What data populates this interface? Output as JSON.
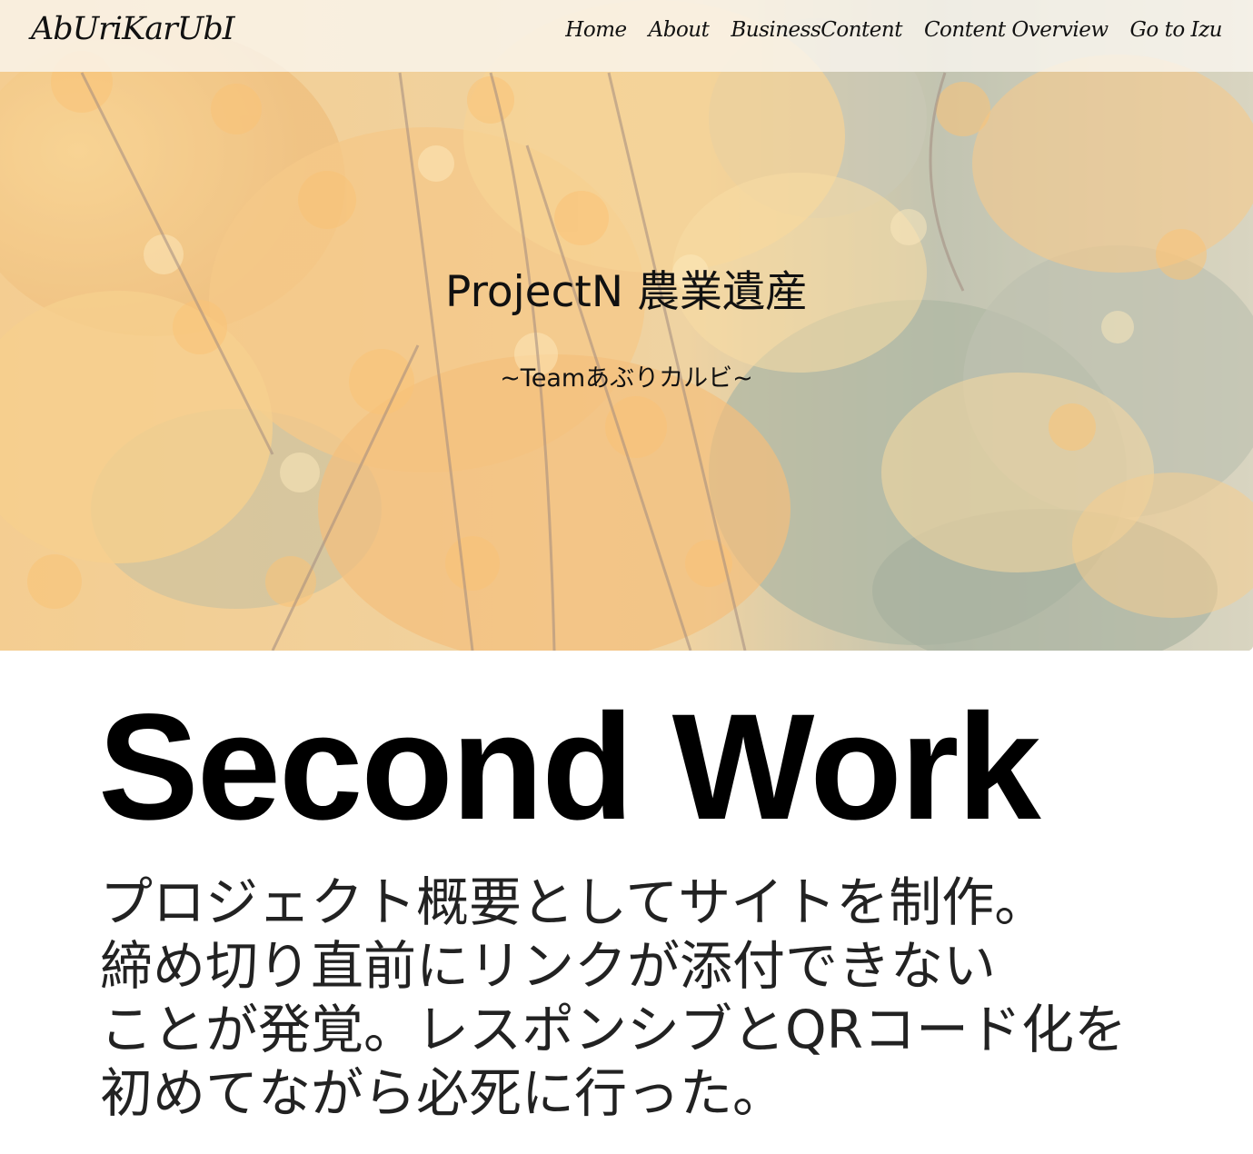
{
  "navbar": {
    "brand": "AbUriKarUbI",
    "links": [
      "Home",
      "About",
      "BusinessContent",
      "Content Overview",
      "Go to Izu"
    ]
  },
  "hero": {
    "title": "ProjectN 農業遺産",
    "subtitle": "~Teamあぶりカルビ~",
    "background": "autumn maple foliage photo"
  },
  "section": {
    "heading": "Second Work",
    "lines": [
      "プロジェクト概要としてサイトを制作。",
      "締め切り直前にリンクが添付できない",
      "ことが発覚。レスポンシブとQRコード化を",
      "初めてながら必死に行った。"
    ]
  },
  "colors": {
    "text": "#111111",
    "navbar_bg": "#faf6f0",
    "foliage_orange": "#f0a040",
    "foliage_yellow": "#f5cf6a"
  }
}
